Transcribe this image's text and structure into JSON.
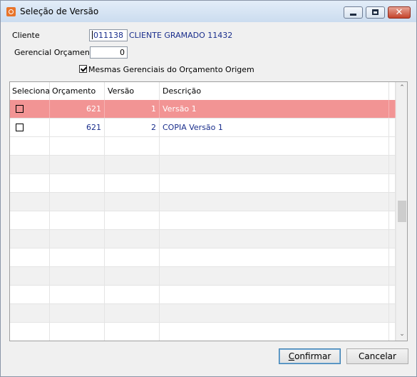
{
  "window": {
    "title": "Seleção de Versão",
    "minimize_glyph": "",
    "maximize_glyph": "",
    "close_glyph": "✕"
  },
  "form": {
    "cliente_label": "Cliente",
    "cliente_id": "011138",
    "cliente_name": "CLIENTE GRAMADO 11432",
    "gerencial_label": "Gerencial Orçamento",
    "gerencial_value": "0",
    "mesmas_label": "Mesmas Gerenciais do Orçamento Origem",
    "mesmas_checked": true
  },
  "grid": {
    "columns": [
      "Selecionar",
      "Orçamento",
      "Versão",
      "Descrição"
    ],
    "rows": [
      {
        "selecionar": false,
        "orcamento": "621",
        "versao": "1",
        "descricao": "Versão 1",
        "highlighted": true
      },
      {
        "selecionar": false,
        "orcamento": "621",
        "versao": "2",
        "descricao": "COPIA Versão 1",
        "highlighted": false
      }
    ],
    "scroll_up_glyph": "⌃",
    "scroll_down_glyph": "⌄",
    "highlight_color": "#f29494",
    "data_text_color": "#1a2e8c"
  },
  "buttons": {
    "confirm_prefix": "C",
    "confirm_rest": "onfirmar",
    "cancel": "Cancelar"
  }
}
